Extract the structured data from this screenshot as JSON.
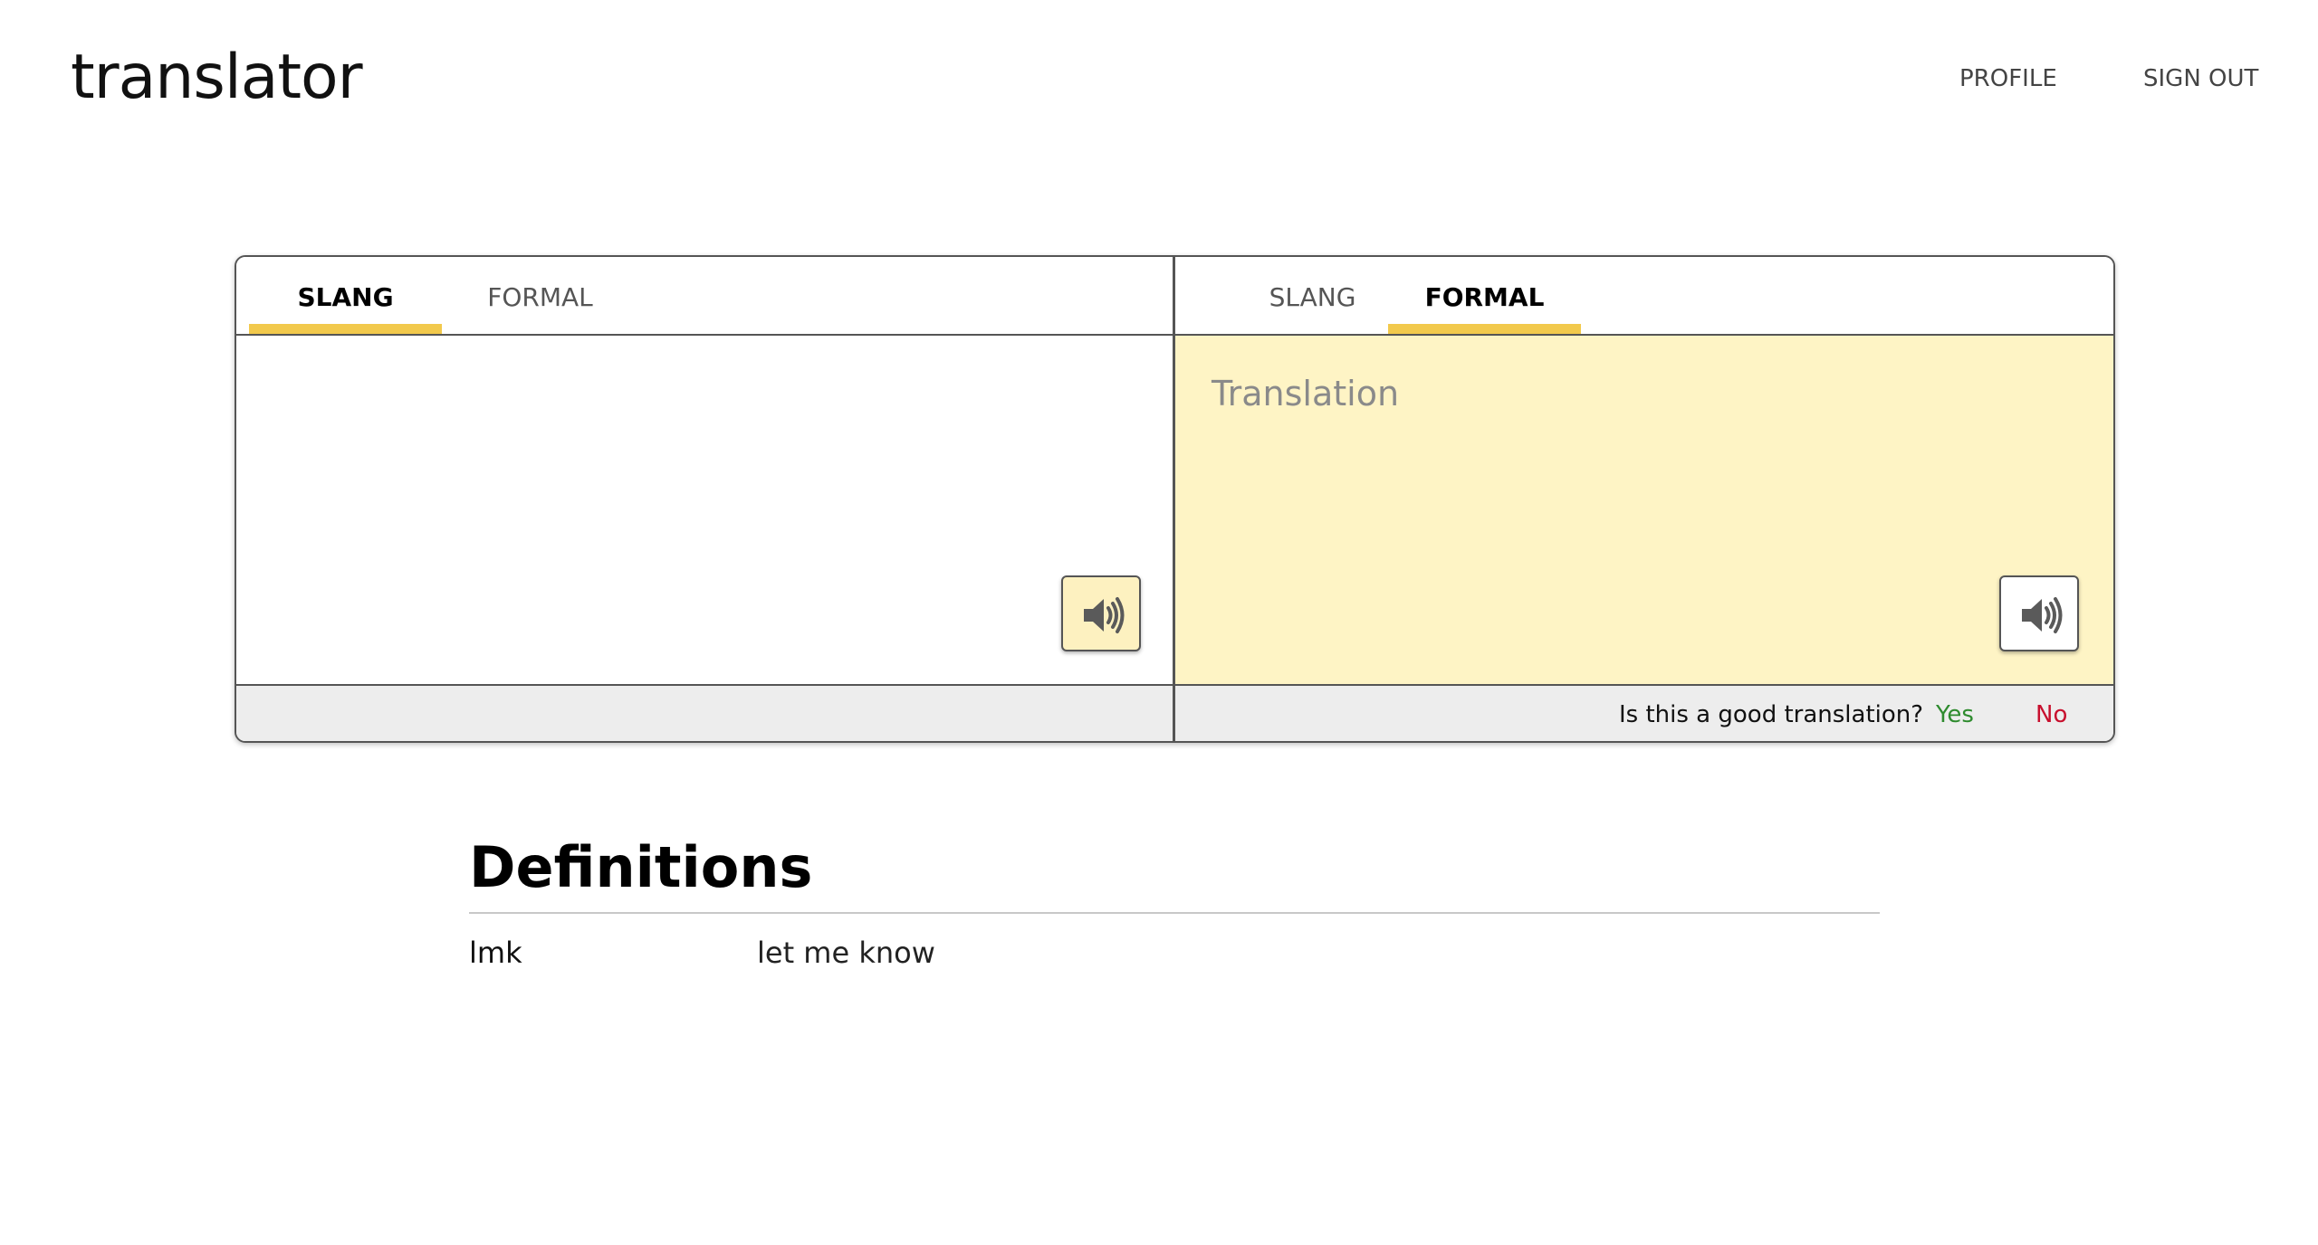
{
  "header": {
    "brand": "translator",
    "nav": [
      {
        "label": "PROFILE"
      },
      {
        "label": "SIGN OUT"
      }
    ]
  },
  "source_pane": {
    "tabs": [
      {
        "label": "SLANG",
        "active": true
      },
      {
        "label": "FORMAL",
        "active": false
      }
    ],
    "input_value": "",
    "speak_icon": "speaker-icon"
  },
  "target_pane": {
    "tabs": [
      {
        "label": "SLANG",
        "active": false
      },
      {
        "label": "FORMAL",
        "active": true
      }
    ],
    "placeholder": "Translation",
    "speak_icon": "speaker-icon",
    "feedback": {
      "question": "Is this a good translation?",
      "yes": "Yes",
      "no": "No"
    }
  },
  "definitions": {
    "title": "Definitions",
    "entries": [
      {
        "term": "lmk",
        "meaning": "let me know"
      }
    ]
  },
  "colors": {
    "accent": "#f2c94c",
    "translation_bg": "#fef4c5",
    "yes": "#2e8b2e",
    "no": "#c8102e"
  }
}
